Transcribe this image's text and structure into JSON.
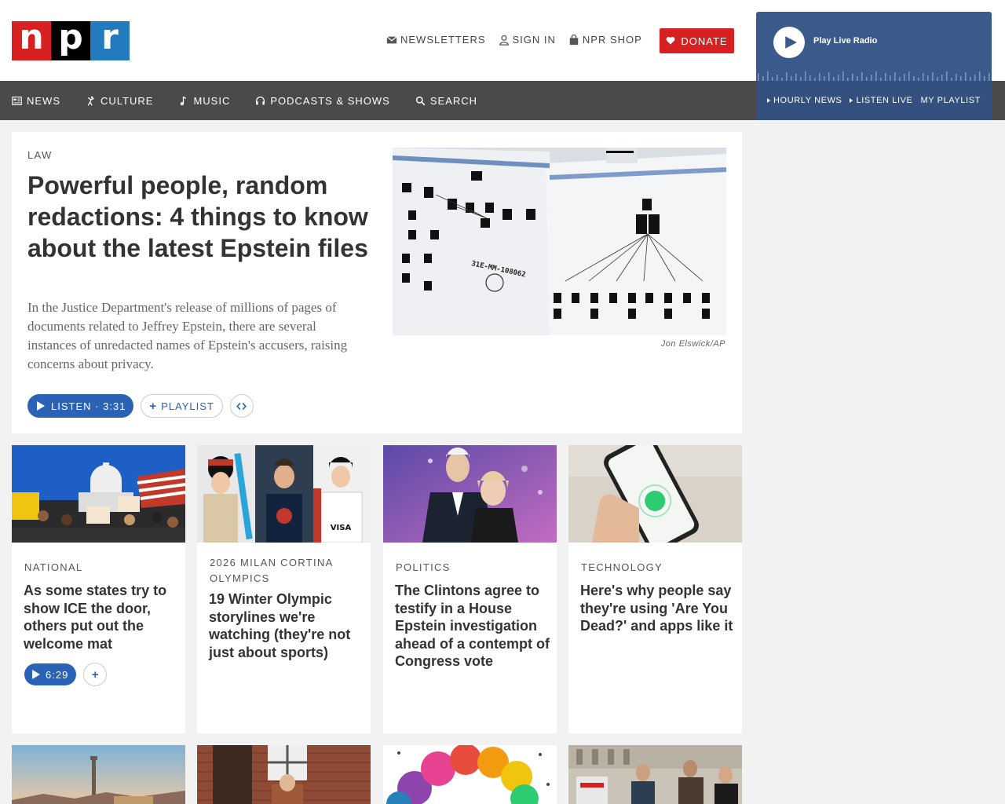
{
  "logo": {
    "n": "n",
    "p": "p",
    "r": "r"
  },
  "utility": [
    {
      "label": "NEWSLETTERS",
      "icon": "envelope-icon"
    },
    {
      "label": "SIGN IN",
      "icon": "user-icon"
    },
    {
      "label": "NPR SHOP",
      "icon": "shopping-bag-icon"
    }
  ],
  "donate": {
    "label": "DONATE",
    "icon": "heart-icon"
  },
  "radio": {
    "label": "Play Live Radio",
    "links": [
      "HOURLY NEWS",
      "LISTEN LIVE",
      "MY PLAYLIST"
    ]
  },
  "nav": [
    {
      "label": "NEWS",
      "icon": "newspaper-icon"
    },
    {
      "label": "CULTURE",
      "icon": "dancer-icon"
    },
    {
      "label": "MUSIC",
      "icon": "music-note-icon"
    },
    {
      "label": "PODCASTS & SHOWS",
      "icon": "headphones-icon"
    },
    {
      "label": "SEARCH",
      "icon": "search-icon"
    }
  ],
  "feature": {
    "kicker": "LAW",
    "headline": "Powerful people, random redactions: 4 things to know about the latest Epstein files",
    "teaser": "In the Justice Department's release of millions of pages of documents related to Jeffrey Epstein, there are several instances of unredacted names of Epstein's accusers, raising concerns about privacy.",
    "photo_text": "31E-MM-108062",
    "credit": "Jon Elswick/AP",
    "listen_label": "LISTEN · 3:31",
    "playlist_label": "PLAYLIST"
  },
  "cards": [
    {
      "kicker": "NATIONAL",
      "headline": "As some states try to show ICE the door, others put out the welcome mat",
      "duration": "6:29"
    },
    {
      "kicker": "2026 MILAN CORTINA OLYMPICS",
      "headline": "19 Winter Olympic storylines we're watching (they're not just about sports)"
    },
    {
      "kicker": "POLITICS",
      "headline": "The Clintons agree to testify in a House Epstein investigation ahead of a contempt of Congress vote"
    },
    {
      "kicker": "TECHNOLOGY",
      "headline": "Here's why people say they're using 'Are You Dead?' and apps like it"
    }
  ],
  "colors": {
    "npr_red": "#d62021",
    "npr_blue": "#237bbd",
    "link_blue": "#2a62b5",
    "nav_gray": "#4a4a4a",
    "radio_blue": "#3a5a8c"
  }
}
